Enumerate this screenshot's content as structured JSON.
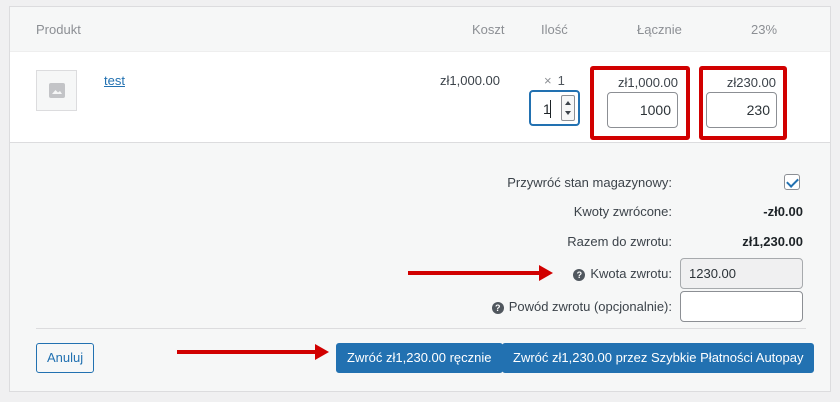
{
  "table": {
    "headers": {
      "product": "Produkt",
      "cost": "Koszt",
      "qty": "Ilość",
      "total": "Łącznie",
      "tax": "23%"
    },
    "item": {
      "name": "test",
      "cost": "zł1,000.00",
      "qty_times": "×",
      "qty": "1",
      "refund_qty": "1",
      "line_total": "zł1,000.00",
      "line_total_refund": "1000",
      "tax_total": "zł230.00",
      "tax_refund": "230"
    }
  },
  "refund": {
    "restock_label": "Przywróć stan magazynowy:",
    "restock_checked": true,
    "refunded_label": "Kwoty zwrócone:",
    "refunded_value": "-zł0.00",
    "available_label": "Razem do zwrotu:",
    "available_value": "zł1,230.00",
    "amount_label": "Kwota zwrotu:",
    "amount_value": "1230.00",
    "reason_label": "Powód zwrotu (opcjonalnie):",
    "reason_value": ""
  },
  "actions": {
    "cancel": "Anuluj",
    "refund_manual": "Zwróć zł1,230.00 ręcznie",
    "refund_gateway": "Zwróć zł1,230.00 przez Szybkie Płatności Autopay"
  },
  "annotation_color": "#d10000",
  "accent_color": "#2271b1"
}
